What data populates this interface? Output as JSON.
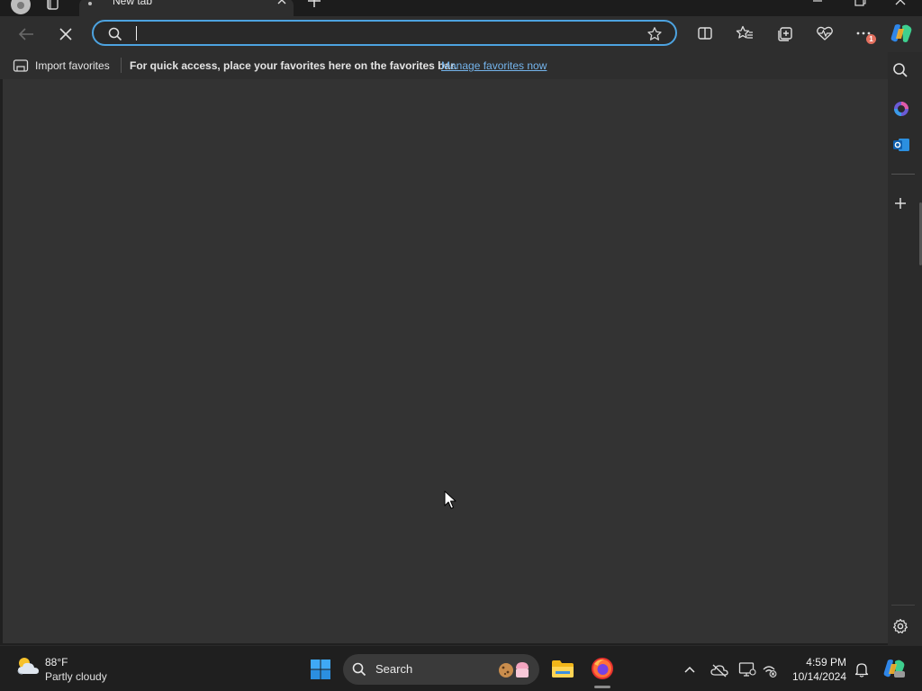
{
  "browser": {
    "tab": {
      "title": "New tab"
    },
    "address_bar": {
      "value": "",
      "placeholder": ""
    },
    "more_badge": "1"
  },
  "favorites_bar": {
    "import_label": "Import favorites",
    "hint_text": "For quick access, place your favorites here on the favorites bar.",
    "manage_link": "Manage favorites now"
  },
  "taskbar": {
    "weather": {
      "temperature": "88°F",
      "condition": "Partly cloudy"
    },
    "search_label": "Search",
    "clock": {
      "time": "4:59 PM",
      "date": "10/14/2024"
    }
  },
  "icons": {
    "toolbar": [
      "back-icon",
      "stop-loading-icon",
      "search-icon",
      "star-icon",
      "split-screen-icon",
      "favorites-icon",
      "collections-icon",
      "browser-essentials-icon",
      "more-icon",
      "copilot-icon"
    ],
    "sidebar": [
      "search-icon",
      "copilot-icon",
      "outlook-icon",
      "add-icon",
      "settings-icon"
    ],
    "taskbar": [
      "weather-icon",
      "windows-start-icon",
      "search-icon",
      "file-explorer-icon",
      "firefox-icon",
      "chevron-up-icon",
      "onedrive-icon",
      "display-icon",
      "network-icon",
      "bell-icon",
      "copilot-icon"
    ]
  },
  "colors": {
    "accent": "#4da3e0",
    "link": "#74b4ec",
    "page_background": "#333333",
    "badge": "#e36f5e"
  }
}
